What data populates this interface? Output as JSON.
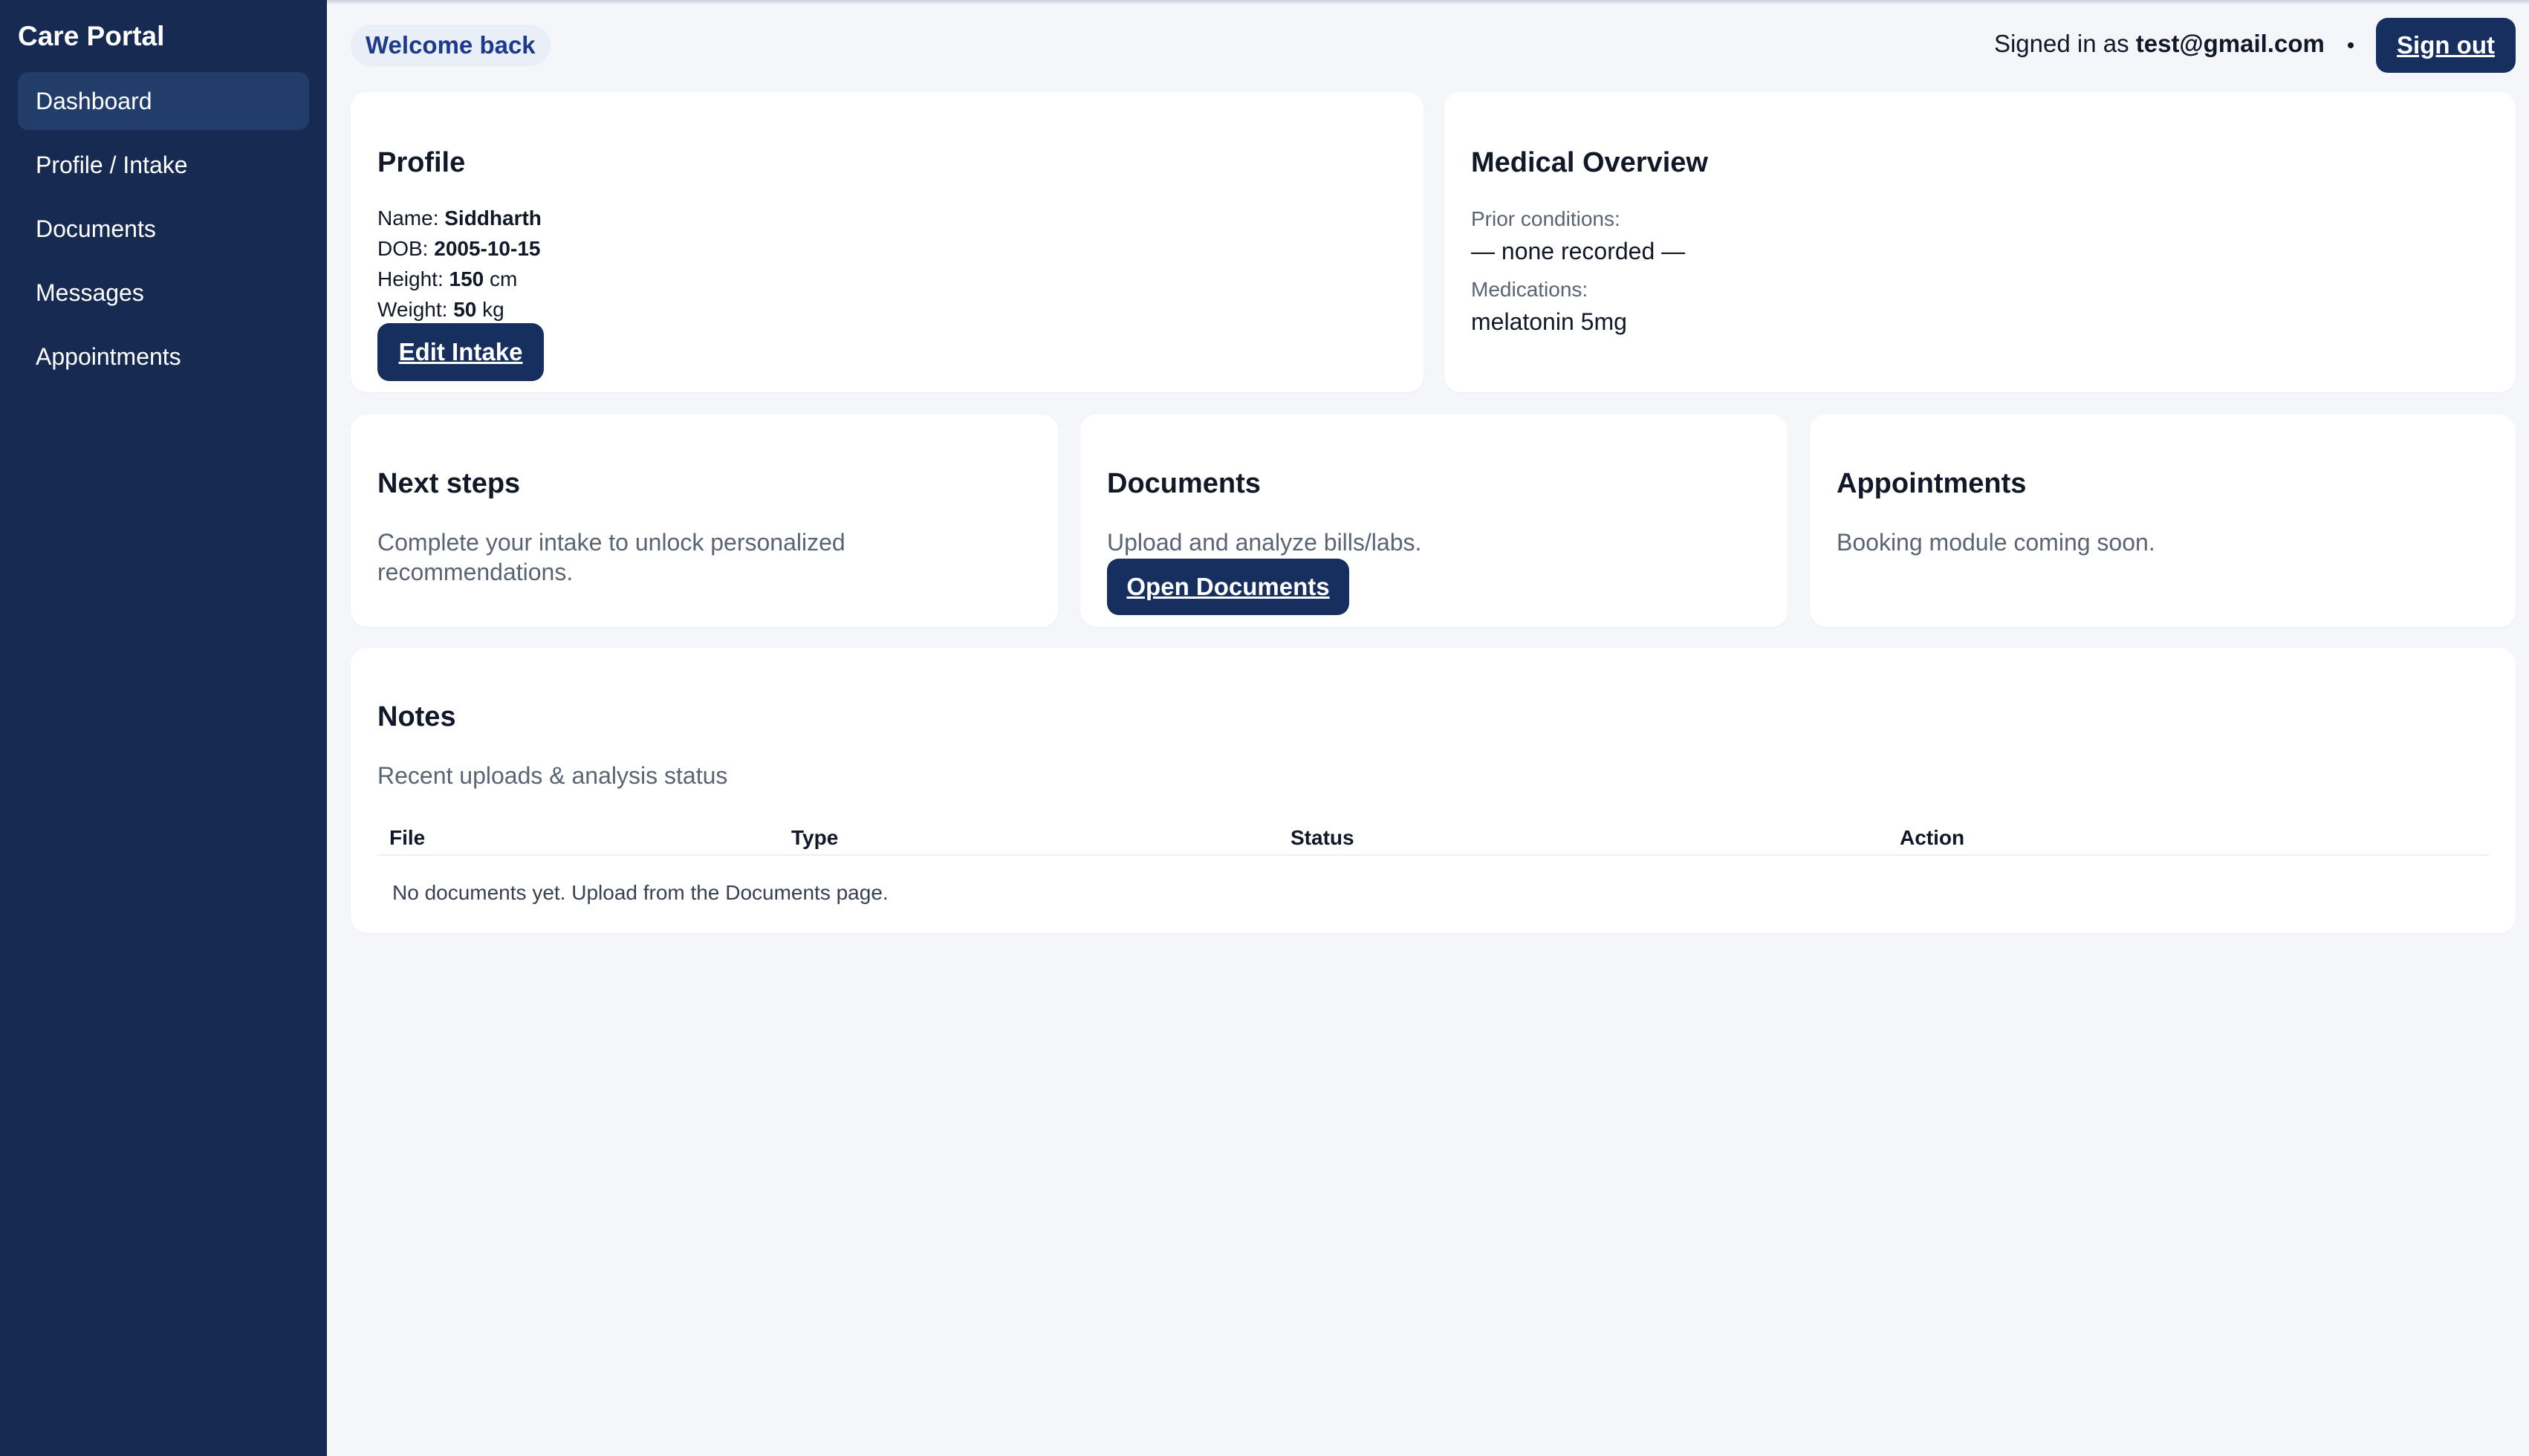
{
  "sidebar": {
    "brand": "Care Portal",
    "items": [
      {
        "label": "Dashboard"
      },
      {
        "label": "Profile / Intake"
      },
      {
        "label": "Documents"
      },
      {
        "label": "Messages"
      },
      {
        "label": "Appointments"
      }
    ]
  },
  "header": {
    "welcome": "Welcome back",
    "signed_in_prefix": "Signed in as",
    "email": "test@gmail.com",
    "sign_out": "Sign out"
  },
  "profile": {
    "title": "Profile",
    "name_label": "Name:",
    "name": "Siddharth",
    "dob_label": "DOB:",
    "dob": "2005-10-15",
    "height_label": "Height:",
    "height": "150",
    "height_unit": "cm",
    "weight_label": "Weight:",
    "weight": "50",
    "weight_unit": "kg",
    "edit_button": "Edit Intake"
  },
  "medical": {
    "title": "Medical Overview",
    "conditions_label": "Prior conditions:",
    "conditions": "— none recorded —",
    "medications_label": "Medications:",
    "medications": "melatonin 5mg"
  },
  "next_steps": {
    "title": "Next steps",
    "text": "Complete your intake to unlock personalized recommendations."
  },
  "documents": {
    "title": "Documents",
    "text": "Upload and analyze bills/labs.",
    "button": "Open Documents"
  },
  "appointments": {
    "title": "Appointments",
    "text": "Booking module coming soon."
  },
  "notes": {
    "title": "Notes",
    "subtitle": "Recent uploads & analysis status",
    "columns": [
      "File",
      "Type",
      "Status",
      "Action"
    ],
    "empty": "No documents yet. Upload from the Documents page."
  },
  "colors": {
    "sidebar": "#172a52",
    "primary_button": "#172f5e",
    "background": "#f4f6fa",
    "welcome_text": "#1e3a8a"
  }
}
